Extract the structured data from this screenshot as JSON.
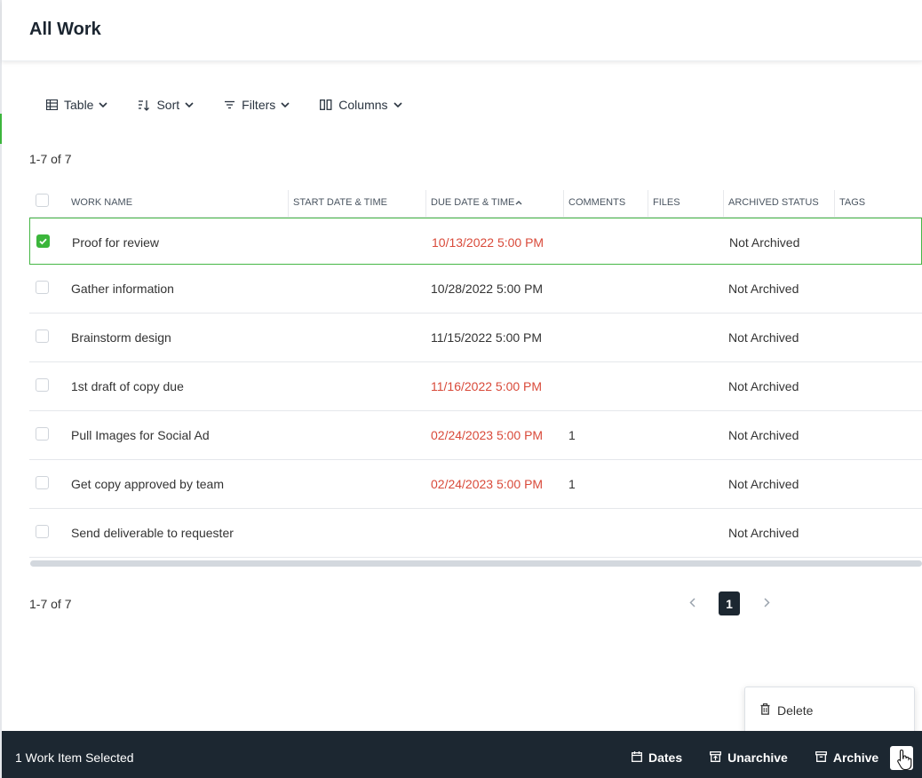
{
  "page": {
    "title": "All Work"
  },
  "toolbar": {
    "table_label": "Table",
    "sort_label": "Sort",
    "filters_label": "Filters",
    "columns_label": "Columns"
  },
  "summary": {
    "top_count": "1-7 of 7",
    "bottom_count": "1-7 of 7"
  },
  "table": {
    "columns": [
      "WORK NAME",
      "START DATE & TIME",
      "DUE DATE & TIME",
      "COMMENTS",
      "FILES",
      "ARCHIVED STATUS",
      "TAGS"
    ],
    "sort_indicator": "^",
    "rows": [
      {
        "name": "Proof for review",
        "start": "",
        "due": "10/13/2022 5:00 PM",
        "overdue": true,
        "comments": "",
        "files": "",
        "status": "Not Archived",
        "tags": "",
        "selected": true
      },
      {
        "name": "Gather information",
        "start": "",
        "due": "10/28/2022 5:00 PM",
        "overdue": false,
        "comments": "",
        "files": "",
        "status": "Not Archived",
        "tags": "",
        "selected": false
      },
      {
        "name": "Brainstorm design",
        "start": "",
        "due": "11/15/2022 5:00 PM",
        "overdue": false,
        "comments": "",
        "files": "",
        "status": "Not Archived",
        "tags": "",
        "selected": false
      },
      {
        "name": "1st draft of copy due",
        "start": "",
        "due": "11/16/2022 5:00 PM",
        "overdue": true,
        "comments": "",
        "files": "",
        "status": "Not Archived",
        "tags": "",
        "selected": false
      },
      {
        "name": "Pull Images for Social Ad",
        "start": "",
        "due": "02/24/2023 5:00 PM",
        "overdue": true,
        "comments": "1",
        "files": "",
        "status": "Not Archived",
        "tags": "",
        "selected": false
      },
      {
        "name": "Get copy approved by team",
        "start": "",
        "due": "02/24/2023 5:00 PM",
        "overdue": true,
        "comments": "1",
        "files": "",
        "status": "Not Archived",
        "tags": "",
        "selected": false
      },
      {
        "name": "Send deliverable to requester",
        "start": "",
        "due": "",
        "overdue": false,
        "comments": "",
        "files": "",
        "status": "Not Archived",
        "tags": "",
        "selected": false
      }
    ]
  },
  "pagination": {
    "current_page": "1"
  },
  "context_menu": {
    "delete_label": "Delete"
  },
  "bottom_bar": {
    "selection_text": "1 Work Item Selected",
    "dates_label": "Dates",
    "unarchive_label": "Unarchive",
    "archive_label": "Archive"
  },
  "colors": {
    "accent_green": "#3bb63b",
    "overdue_red": "#d94a3a",
    "dark_bar": "#1c2731"
  }
}
